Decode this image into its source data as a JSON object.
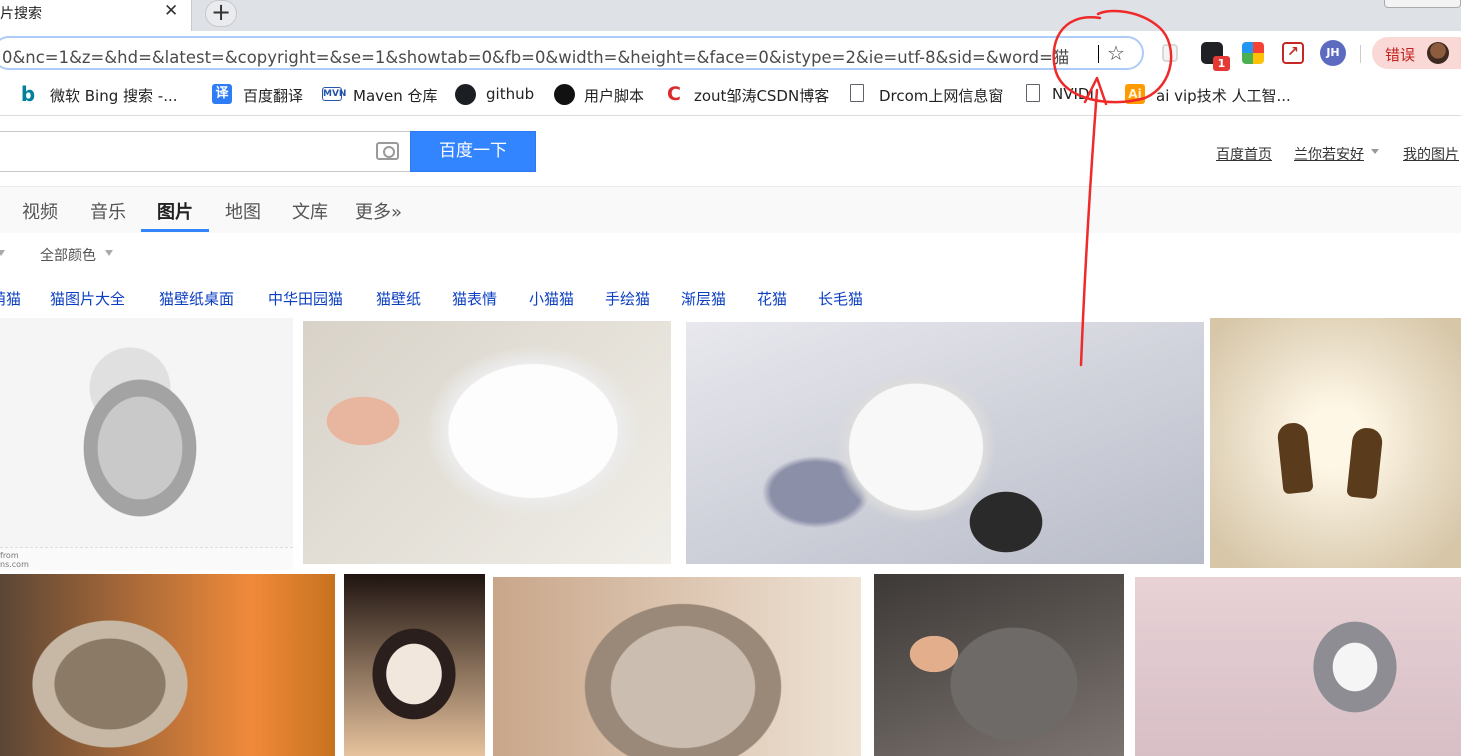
{
  "tab": {
    "title": "图片搜索",
    "close_glyph": "✕",
    "new_tab_glyph": "+"
  },
  "address_bar": {
    "url": "0&nc=1&z=&hd=&latest=&copyright=&se=1&showtab=0&fb=0&width=&height=&face=0&istype=2&ie=utf-8&sid=&word=猫",
    "star_glyph": "☆"
  },
  "extensions": {
    "chat_badge": "1",
    "pdf_label": "↗",
    "profile_initials": "JH",
    "error_label": "错误"
  },
  "bookmarks": [
    {
      "label": "微软 Bing 搜索 -...",
      "icon": "bing-icon"
    },
    {
      "label": "百度翻译",
      "icon": "fanyi-icon"
    },
    {
      "label": "Maven 仓库",
      "icon": "maven-icon"
    },
    {
      "label": "github",
      "icon": "github-icon"
    },
    {
      "label": "用户脚本",
      "icon": "userscript-icon"
    },
    {
      "label": "zout邹涛CSDN博客",
      "icon": "csdn-icon"
    },
    {
      "label": "Drcom上网信息窗",
      "icon": "page-icon"
    },
    {
      "label": "NVIDI",
      "icon": "page-icon"
    },
    {
      "label": "ai vip技术 人工智...",
      "icon": "ai-icon"
    }
  ],
  "bookmark_icon_glyphs": {
    "bing": "b",
    "fanyi": "译",
    "maven": "MVN",
    "csdn": "C",
    "ai": "Ai"
  },
  "search": {
    "button_label": "百度一下"
  },
  "top_links": {
    "home": "百度首页",
    "user": "兰你若安好",
    "my_images": "我的图片"
  },
  "nav": {
    "items": [
      "视频",
      "音乐",
      "图片",
      "地图",
      "文库",
      "更多»"
    ],
    "active": "图片"
  },
  "filters": {
    "color": "全部颜色"
  },
  "related": [
    "萌猫",
    "猫图片大全",
    "猫壁纸桌面",
    "中华田园猫",
    "猫壁纸",
    "猫表情",
    "小猫猫",
    "手绘猫",
    "渐层猫",
    "花猫",
    "长毛猫"
  ],
  "related_first_visible": "萌猫",
  "image1_caption": "from\nns.com",
  "colors": {
    "baidu_blue": "#3385ff",
    "link_blue": "#0b3ec2",
    "annotation_red": "#ee2a2a",
    "error_red": "#c5221f"
  }
}
